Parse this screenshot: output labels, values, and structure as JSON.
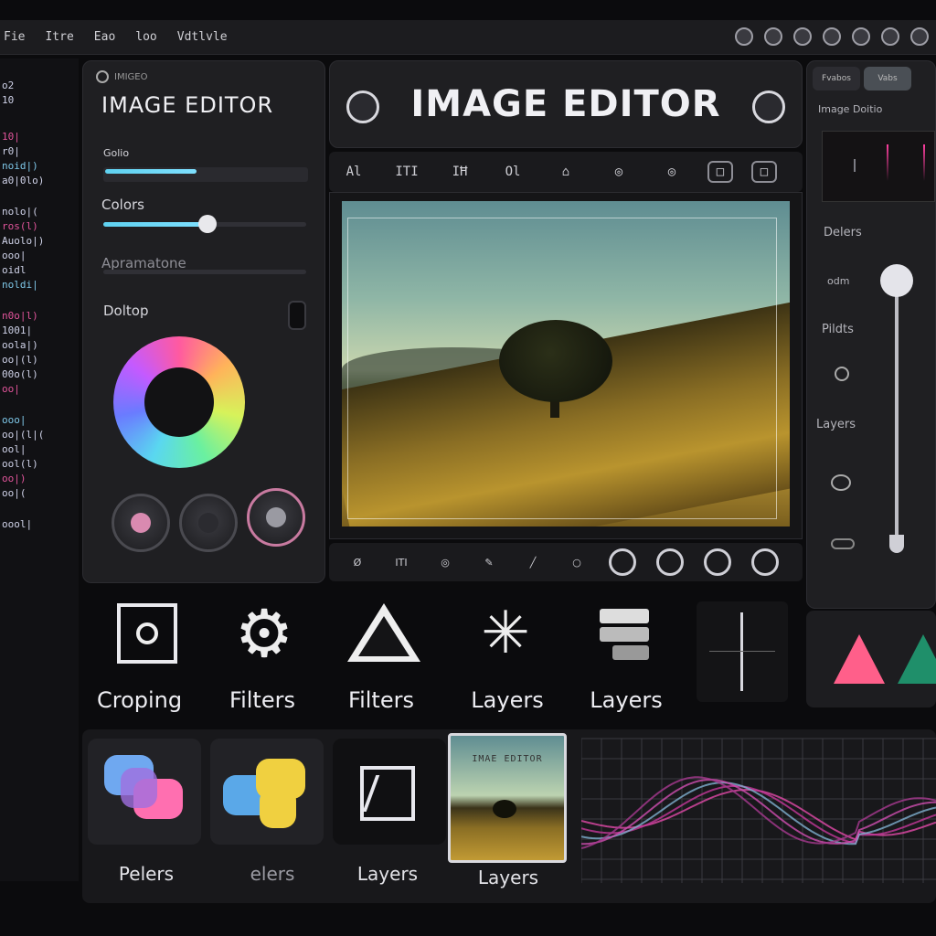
{
  "menubar": {
    "items": [
      "Fie",
      "Itre",
      "Eao",
      "loo",
      "Vdtlvle"
    ],
    "tray_icons": [
      "camera-icon",
      "shield-icon",
      "camera-icon",
      "ring-icon",
      "flag-icon",
      "globe-icon",
      "globe-icon"
    ]
  },
  "code_lines": [
    "o2",
    "10",
    "10|",
    "r0|",
    "noid|)",
    "a0|0lo)",
    "nolo|(",
    "ros(l)",
    "Auolo|)",
    "ooo|",
    "oidl",
    "noldi|",
    "n0o|l)",
    "1001|",
    "oola|)",
    "oo|(l)",
    "00o(l)",
    "oo|",
    "ooo|",
    "oo|(l|(",
    "ool|",
    "ool(l)",
    "oo|)",
    "oo|(",
    "oool|"
  ],
  "left_panel": {
    "tab_label": "IMIGEO",
    "title": "IMAGE EDITOR",
    "sliders": [
      {
        "label": "Golio",
        "level": 0.38
      },
      {
        "label": "Colors",
        "level": 0.52
      },
      {
        "label": "Apramatone",
        "level": 0.0
      }
    ],
    "toggle_label": "Doltop"
  },
  "header": {
    "title": "IMAGE EDITOR"
  },
  "toolbar": {
    "buttons": [
      "Al",
      "ITI",
      "IĦ",
      "Ol",
      "⌂",
      "◎",
      "◎",
      "□",
      "□"
    ]
  },
  "canvas": {
    "image": "landscape-tree-meadow"
  },
  "bottom_toolbar": {
    "buttons": [
      "Ø",
      "ITI",
      "◎",
      "✎",
      "╱",
      "○",
      "◎",
      "◎",
      "◎",
      "◎"
    ]
  },
  "right_panel": {
    "tabs": [
      "Fvabos",
      "Vabs"
    ],
    "title": "Image Doitio",
    "labels": [
      "Delers",
      "odm",
      "Pildts",
      "Layers"
    ],
    "slider_level": 0.05
  },
  "tools": [
    {
      "label": "Croping",
      "icon": "crop-icon"
    },
    {
      "label": "Filters",
      "icon": "gear-icon"
    },
    {
      "label": "Filters",
      "icon": "triangle-icon"
    },
    {
      "label": "Layers",
      "icon": "sparkle-icon"
    },
    {
      "label": "Layers",
      "icon": "layers-icon"
    }
  ],
  "assets": [
    {
      "label": "Pelers"
    },
    {
      "label": "elers"
    },
    {
      "label": "Layers"
    },
    {
      "label": "Layers"
    }
  ],
  "thumbnail_title": "IMAE EDITOR"
}
